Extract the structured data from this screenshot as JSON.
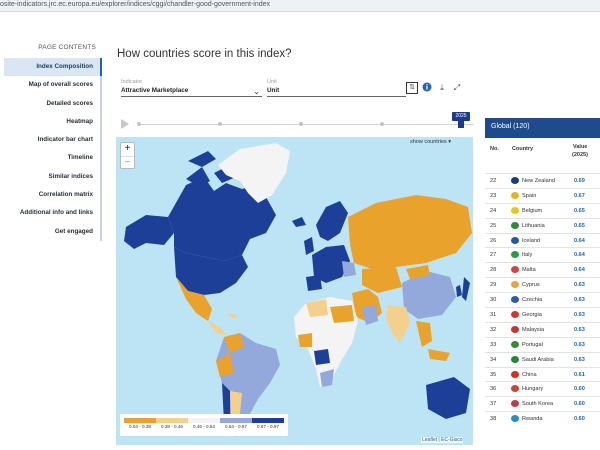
{
  "browser": {
    "url": "osite-indicators.jrc.ec.europa.eu/explorer/indices/cggi/chandler-good-government-index"
  },
  "sidebar": {
    "heading": "PAGE CONTENTS",
    "items": [
      {
        "label": "Index Composition",
        "active": true
      },
      {
        "label": "Map of overall scores"
      },
      {
        "label": "Detailed scores"
      },
      {
        "label": "Heatmap"
      },
      {
        "label": "Indicator bar chart"
      },
      {
        "label": "Timeline"
      },
      {
        "label": "Similar indices"
      },
      {
        "label": "Correlation matrix"
      },
      {
        "label": "Additional info and links"
      },
      {
        "label": "Get engaged"
      }
    ]
  },
  "main": {
    "title": "How countries score in this index?",
    "indicator_label": "Indicator",
    "indicator_value": "Attractive Marketplace",
    "unit_label": "Unit",
    "unit_value": "Unit",
    "timeline_year": "2025",
    "show_countries": "show countries ▾",
    "zoom_in": "+",
    "zoom_out": "−",
    "attribution": "Leaflet | EC-Gisco",
    "icons": {
      "sort": "sort-icon",
      "info": "info-icon",
      "download": "download-icon",
      "fullscreen": "fullscreen-icon",
      "play": "play-icon"
    }
  },
  "legend": {
    "bins": [
      {
        "label": "0.04 - 0.38",
        "color": "#e9a22c"
      },
      {
        "label": "0.38 - 0.46",
        "color": "#f3d08c"
      },
      {
        "label": "0.46 - 0.54",
        "color": "#f4f4f4"
      },
      {
        "label": "0.54 - 0.67",
        "color": "#93a8db"
      },
      {
        "label": "0.67 - 0.97",
        "color": "#1d3f98"
      }
    ]
  },
  "table": {
    "title": "Global (120)",
    "headers": {
      "no": "No.",
      "country": "Country",
      "value": "Value",
      "value_year": "(2025)"
    },
    "rows": [
      {
        "no": "22",
        "country": "New Zealand",
        "value": "0.69",
        "flag": "#1c3c7a"
      },
      {
        "no": "23",
        "country": "Spain",
        "value": "0.67",
        "flag": "#e2b323"
      },
      {
        "no": "24",
        "country": "Belgium",
        "value": "0.65",
        "flag": "#e8c520"
      },
      {
        "no": "25",
        "country": "Lithuania",
        "value": "0.65",
        "flag": "#2e8b3a"
      },
      {
        "no": "26",
        "country": "Iceland",
        "value": "0.64",
        "flag": "#2456a8"
      },
      {
        "no": "27",
        "country": "Italy",
        "value": "0.64",
        "flag": "#2b9b45"
      },
      {
        "no": "28",
        "country": "Malta",
        "value": "0.64",
        "flag": "#d54545"
      },
      {
        "no": "29",
        "country": "Cyprus",
        "value": "0.63",
        "flag": "#e5a83c"
      },
      {
        "no": "30",
        "country": "Czechia",
        "value": "0.63",
        "flag": "#2c5ab0"
      },
      {
        "no": "31",
        "country": "Georgia",
        "value": "0.63",
        "flag": "#d73535"
      },
      {
        "no": "32",
        "country": "Malaysia",
        "value": "0.63",
        "flag": "#c93333"
      },
      {
        "no": "33",
        "country": "Portugal",
        "value": "0.63",
        "flag": "#3a8a34"
      },
      {
        "no": "34",
        "country": "Saudi Arabia",
        "value": "0.63",
        "flag": "#1f8a3b"
      },
      {
        "no": "35",
        "country": "China",
        "value": "0.61",
        "flag": "#d92d20"
      },
      {
        "no": "36",
        "country": "Hungary",
        "value": "0.60",
        "flag": "#c8453a"
      },
      {
        "no": "37",
        "country": "South Korea",
        "value": "0.60",
        "flag": "#c03a4a"
      },
      {
        "no": "38",
        "country": "Rwanda",
        "value": "0.60",
        "flag": "#2a8fc9"
      }
    ]
  }
}
